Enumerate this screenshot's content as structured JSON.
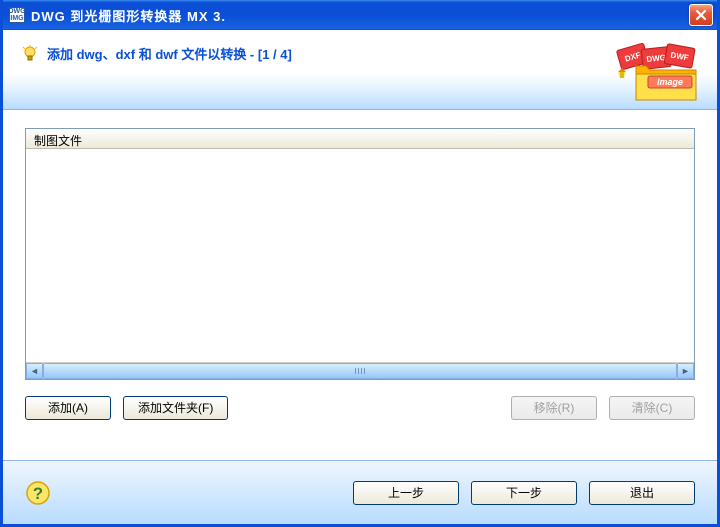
{
  "titlebar": {
    "app_icon_text": "DWG\nIMG",
    "title": "DWG 到光栅图形转换器 MX 3."
  },
  "header": {
    "hint": "添加 dwg、dxf 和 dwf 文件以转换 - [1 / 4]",
    "folder_labels": {
      "dxf": "DXF",
      "dwg": "DWG",
      "dwf": "DWF",
      "image": "Image"
    }
  },
  "list": {
    "column_header": "制图文件"
  },
  "buttons": {
    "add": "添加(A)",
    "add_folder": "添加文件夹(F)",
    "remove": "移除(R)",
    "clear": "清除(C)"
  },
  "footer": {
    "prev": "上一步",
    "next": "下一步",
    "exit": "退出"
  }
}
